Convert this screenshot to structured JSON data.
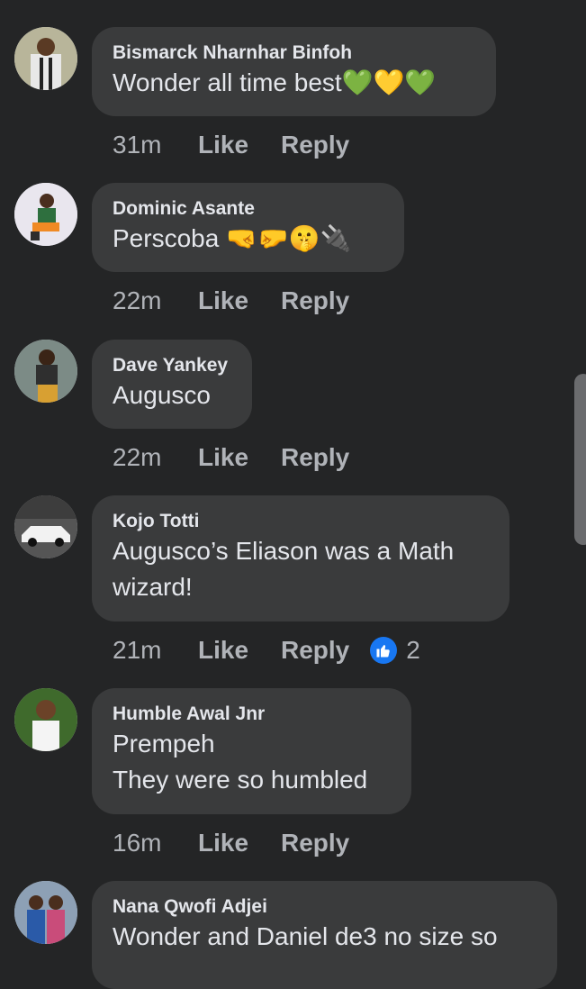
{
  "comments": [
    {
      "author": "Bismarck Nharnhar Binfoh",
      "lines": [
        "Wonder all time best💚💛💚"
      ],
      "time": "31m",
      "like": "Like",
      "reply": "Reply"
    },
    {
      "author": "Dominic Asante",
      "lines": [
        "Perscoba 🤜🤛🤫🔌"
      ],
      "time": "22m",
      "like": "Like",
      "reply": "Reply"
    },
    {
      "author": "Dave Yankey",
      "lines": [
        "Augusco"
      ],
      "time": "22m",
      "like": "Like",
      "reply": "Reply"
    },
    {
      "author": "Kojo Totti",
      "lines": [
        "Augusco’s Eliason was a Math",
        "wizard!"
      ],
      "time": "21m",
      "like": "Like",
      "reply": "Reply",
      "reactions": "2"
    },
    {
      "author": "Humble Awal Jnr",
      "lines": [
        "Prempeh",
        "They were so humbled"
      ],
      "time": "16m",
      "like": "Like",
      "reply": "Reply"
    },
    {
      "author": "Nana Qwofi Adjei",
      "lines": [
        "Wonder and Daniel de3 no size so"
      ]
    }
  ],
  "colors": {
    "background": "#242526",
    "bubble": "#3a3b3c",
    "like_blue": "#1877f2"
  }
}
